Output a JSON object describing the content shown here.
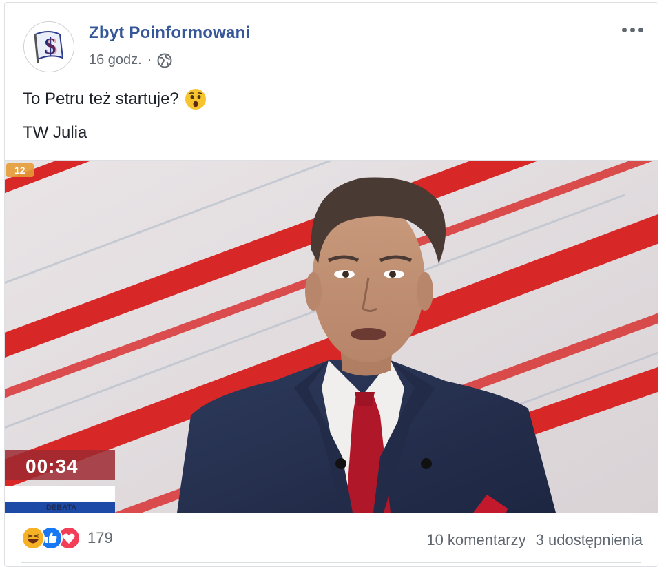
{
  "post": {
    "page_name": "Zbyt Poinformowani",
    "time": "16 godz.",
    "separator": "·",
    "privacy_icon": "globe-icon",
    "more_icon": "more-options-icon",
    "text_line1": "To Petru też startuje?",
    "text_emoji": "astonished-face-emoji",
    "text_line2": "TW Julia"
  },
  "photo": {
    "timer": "00:34",
    "banner": "DEBATA",
    "channel_badge": "12"
  },
  "footer": {
    "reaction_icons": [
      "haha-icon",
      "like-icon",
      "love-icon"
    ],
    "reaction_count": "179",
    "comments": "10 komentarzy",
    "shares": "3 udostępnienia"
  },
  "colors": {
    "link": "#365899",
    "text": "#1d2129",
    "meta": "#616770",
    "like": "#1877f2",
    "love": "#f33e58",
    "haha": "#f7b125",
    "stripe": "#d81e1e",
    "suit": "#27324f",
    "tie": "#b0182a"
  }
}
